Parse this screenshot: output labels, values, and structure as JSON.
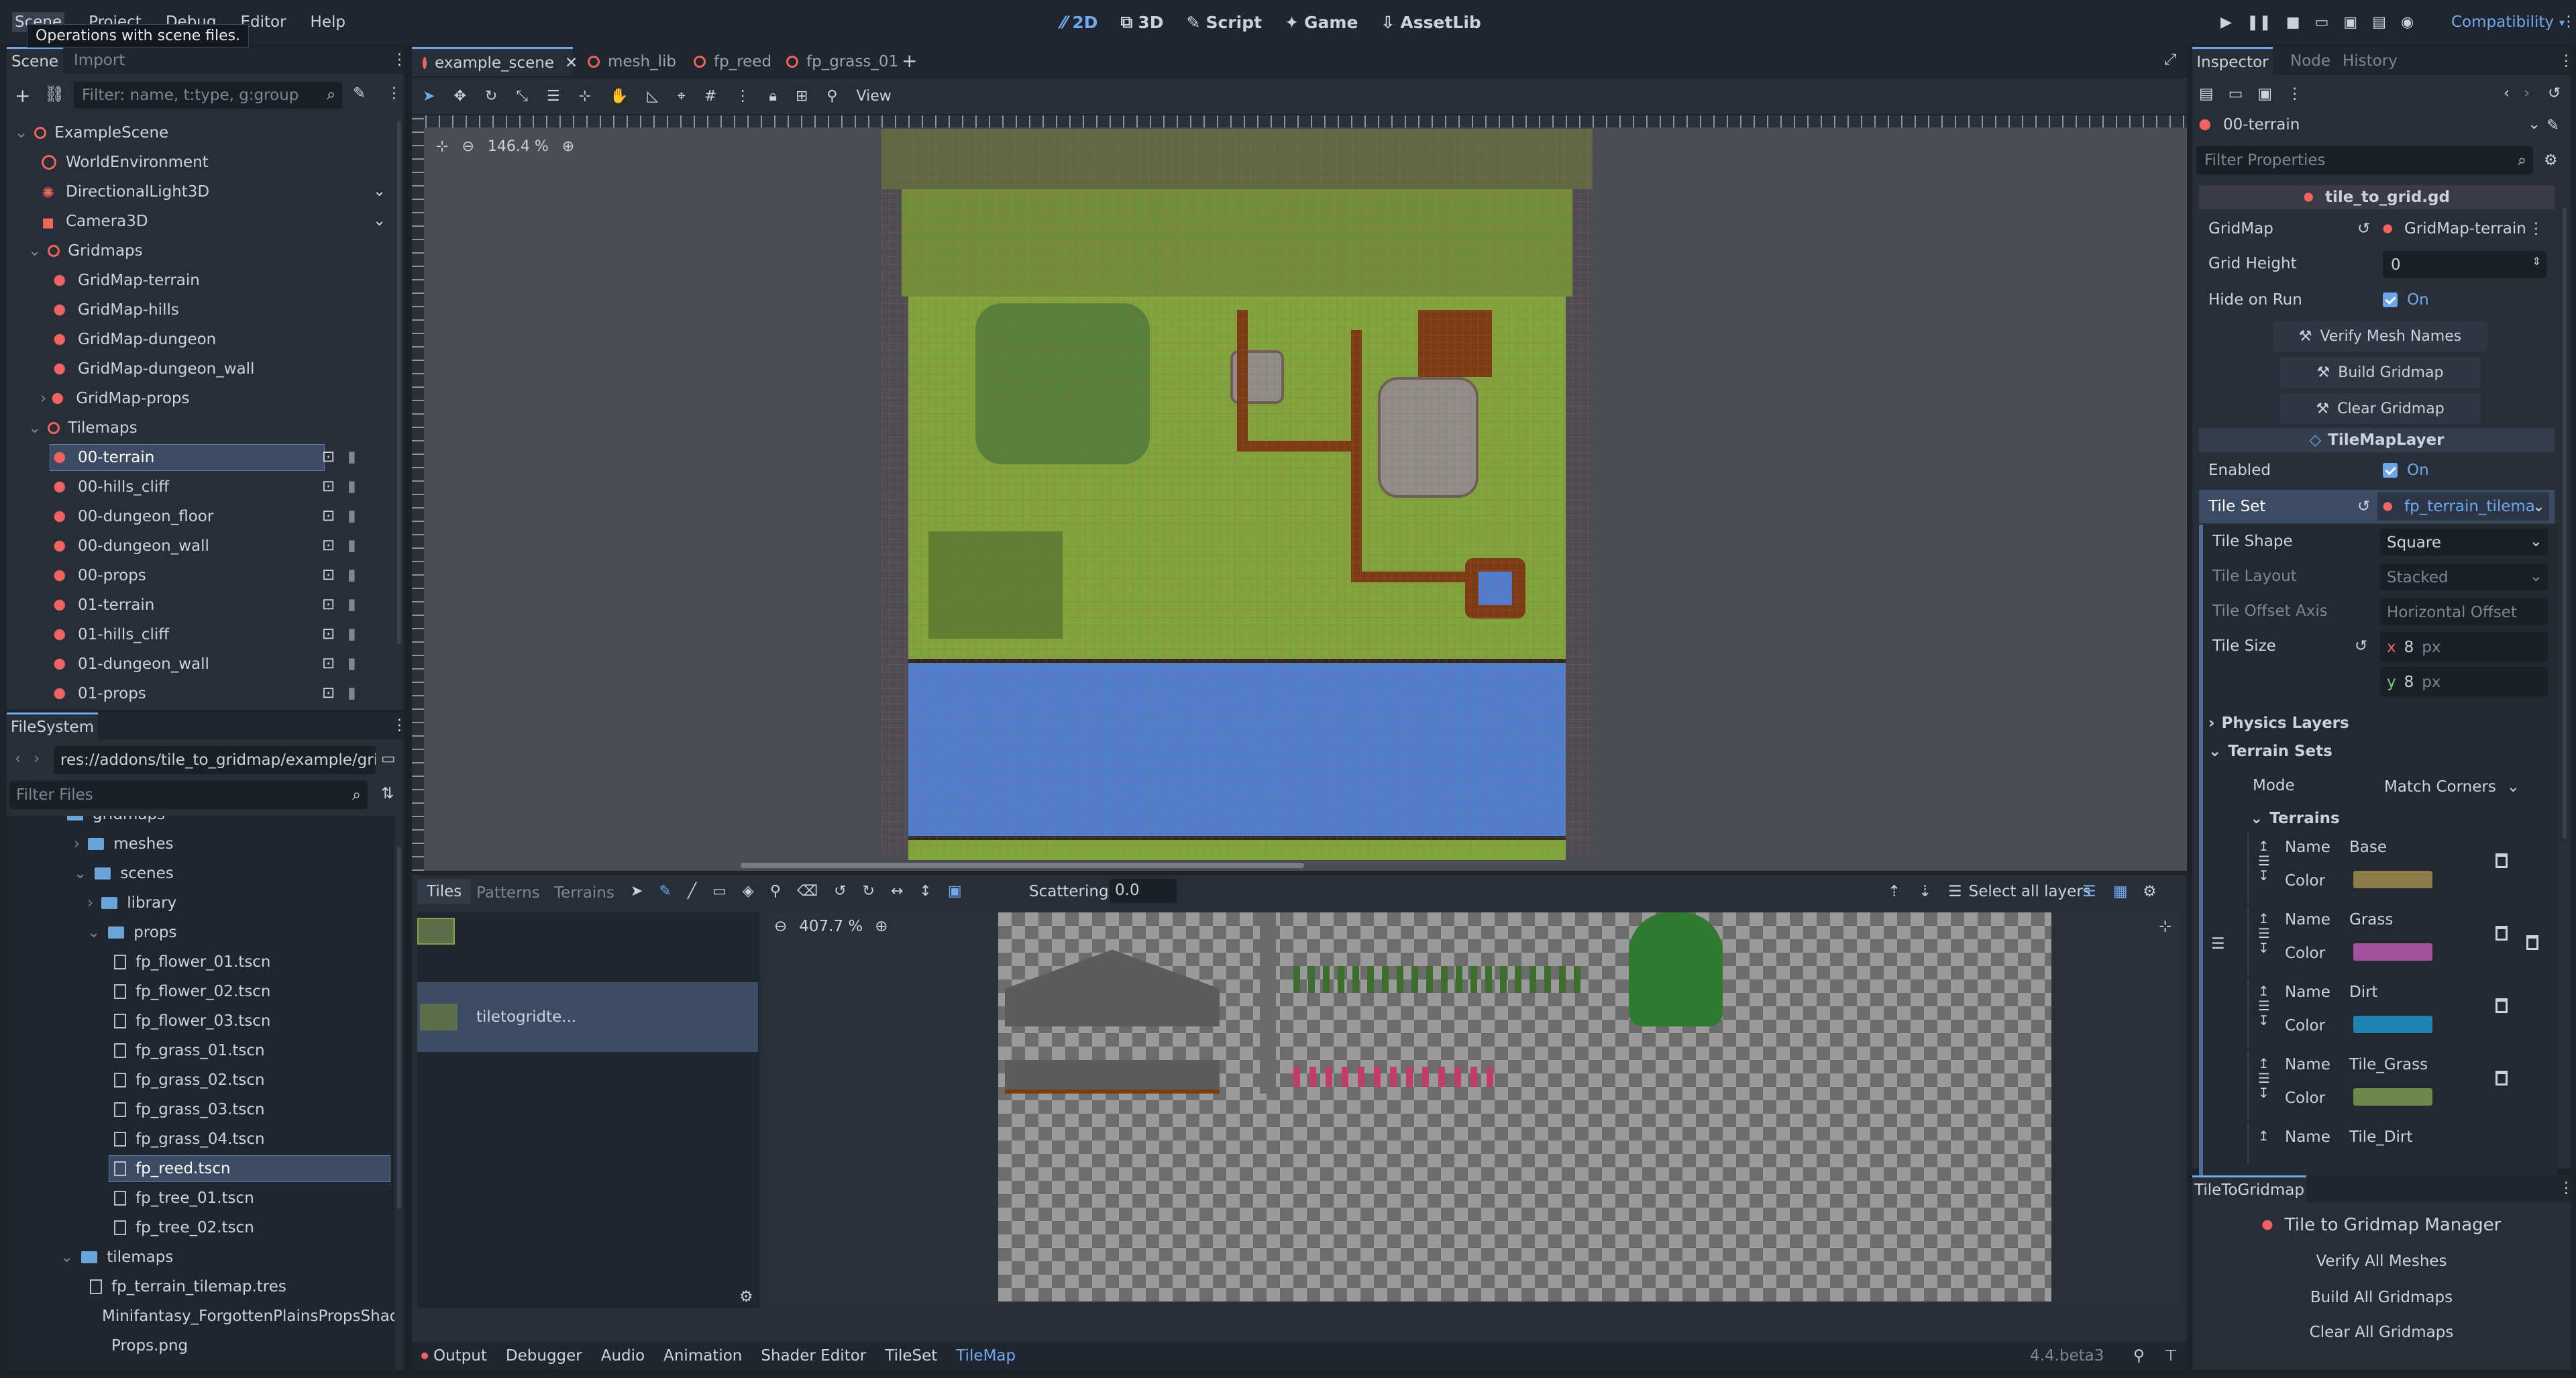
{
  "menu": {
    "items": [
      "Scene",
      "Project",
      "Debug",
      "Editor",
      "Help"
    ],
    "tooltip": "Operations with scene files."
  },
  "workspaces": [
    "2D",
    "3D",
    "Script",
    "Game",
    "AssetLib"
  ],
  "renderer": "Compatibility",
  "scene_dock": {
    "tabs": [
      "Scene",
      "Import"
    ],
    "filter_placeholder": "Filter: name, t:type, g:group",
    "tree": [
      {
        "label": "ExampleScene",
        "depth": 0
      },
      {
        "label": "WorldEnvironment",
        "depth": 1
      },
      {
        "label": "DirectionalLight3D",
        "depth": 1
      },
      {
        "label": "Camera3D",
        "depth": 1
      },
      {
        "label": "Gridmaps",
        "depth": 1
      },
      {
        "label": "GridMap-terrain",
        "depth": 2
      },
      {
        "label": "GridMap-hills",
        "depth": 2
      },
      {
        "label": "GridMap-dungeon",
        "depth": 2
      },
      {
        "label": "GridMap-dungeon_wall",
        "depth": 2
      },
      {
        "label": "GridMap-props",
        "depth": 2
      },
      {
        "label": "Tilemaps",
        "depth": 1
      },
      {
        "label": "00-terrain",
        "depth": 2
      },
      {
        "label": "00-hills_cliff",
        "depth": 2
      },
      {
        "label": "00-dungeon_floor",
        "depth": 2
      },
      {
        "label": "00-dungeon_wall",
        "depth": 2
      },
      {
        "label": "00-props",
        "depth": 2
      },
      {
        "label": "01-terrain",
        "depth": 2
      },
      {
        "label": "01-hills_cliff",
        "depth": 2
      },
      {
        "label": "01-dungeon_wall",
        "depth": 2
      },
      {
        "label": "01-props",
        "depth": 2
      }
    ]
  },
  "filesystem": {
    "title": "FileSystem",
    "path": "res://addons/tile_to_gridmap/example/gridm",
    "filter_placeholder": "Filter Files",
    "items": [
      {
        "label": "gridmaps",
        "type": "folder",
        "depth": 1
      },
      {
        "label": "meshes",
        "type": "folder",
        "depth": 2
      },
      {
        "label": "scenes",
        "type": "folder",
        "depth": 2
      },
      {
        "label": "library",
        "type": "folder",
        "depth": 3
      },
      {
        "label": "props",
        "type": "folder",
        "depth": 3
      },
      {
        "label": "fp_flower_01.tscn",
        "type": "file",
        "depth": 4
      },
      {
        "label": "fp_flower_02.tscn",
        "type": "file",
        "depth": 4
      },
      {
        "label": "fp_flower_03.tscn",
        "type": "file",
        "depth": 4
      },
      {
        "label": "fp_grass_01.tscn",
        "type": "file",
        "depth": 4
      },
      {
        "label": "fp_grass_02.tscn",
        "type": "file",
        "depth": 4
      },
      {
        "label": "fp_grass_03.tscn",
        "type": "file",
        "depth": 4
      },
      {
        "label": "fp_grass_04.tscn",
        "type": "file",
        "depth": 4
      },
      {
        "label": "fp_reed.tscn",
        "type": "file",
        "depth": 4
      },
      {
        "label": "fp_tree_01.tscn",
        "type": "file",
        "depth": 4
      },
      {
        "label": "fp_tree_02.tscn",
        "type": "file",
        "depth": 4
      },
      {
        "label": "tilemaps",
        "type": "folder",
        "depth": 2
      },
      {
        "label": "fp_terrain_tilemap.tres",
        "type": "file",
        "depth": 3
      },
      {
        "label": "Minifantasy_ForgottenPlainsPropsShad...",
        "type": "file",
        "depth": 3
      },
      {
        "label": "Props.png",
        "type": "file",
        "depth": 3
      }
    ]
  },
  "editor_tabs": [
    "example_scene",
    "mesh_lib",
    "fp_reed",
    "fp_grass_01"
  ],
  "viewport": {
    "zoom": "146.4 %",
    "view_label": "View"
  },
  "tilemap_panel": {
    "tabs": [
      "Tiles",
      "Patterns",
      "Terrains"
    ],
    "scattering_label": "Scattering:",
    "scattering_value": "0.0",
    "select_layers": "Select all layers",
    "atlas_zoom": "407.7 %",
    "source_name": "tiletogridte..."
  },
  "bottom_tabs": [
    "Output",
    "Debugger",
    "Audio",
    "Animation",
    "Shader Editor",
    "TileSet",
    "TileMap"
  ],
  "version": "4.4.beta3",
  "inspector": {
    "tabs": [
      "Inspector",
      "Node",
      "History"
    ],
    "node_name": "00-terrain",
    "filter_placeholder": "Filter Properties",
    "script_header": "tile_to_grid.gd",
    "props": {
      "gridmap": {
        "label": "GridMap",
        "value": "GridMap-terrain"
      },
      "grid_height": {
        "label": "Grid Height",
        "value": "0"
      },
      "hide_on_run": {
        "label": "Hide on Run",
        "value": "On"
      }
    },
    "buttons": [
      "Verify Mesh Names",
      "Build Gridmap",
      "Clear Gridmap"
    ],
    "layer_header": "TileMapLayer",
    "enabled": {
      "label": "Enabled",
      "value": "On"
    },
    "tile_set": {
      "label": "Tile Set",
      "value": "fp_terrain_tilema"
    },
    "tile_shape": {
      "label": "Tile Shape",
      "value": "Square"
    },
    "tile_layout": {
      "label": "Tile Layout",
      "value": "Stacked"
    },
    "tile_offset": {
      "label": "Tile Offset Axis",
      "value": "Horizontal Offset"
    },
    "tile_size": {
      "label": "Tile Size",
      "x": "8",
      "y": "8",
      "unit": "px"
    },
    "physics_layers": "Physics Layers",
    "terrain_sets": "Terrain Sets",
    "mode": {
      "label": "Mode",
      "value": "Match Corners"
    },
    "terrains_label": "Terrains",
    "terrains": [
      {
        "name": "Base",
        "color": "#8c7a48"
      },
      {
        "name": "Grass",
        "color": "#a2519f"
      },
      {
        "name": "Dirt",
        "color": "#1f83b3"
      },
      {
        "name": "Tile_Grass",
        "color": "#6b8a49"
      },
      {
        "name": "Tile_Dirt",
        "color": ""
      }
    ],
    "name_label": "Name",
    "color_label": "Color"
  },
  "tile_to_gridmap": {
    "tab": "TileToGridmap",
    "title": "Tile to Gridmap Manager",
    "buttons": [
      "Verify All Meshes",
      "Build All Gridmaps",
      "Clear All Gridmaps"
    ]
  }
}
